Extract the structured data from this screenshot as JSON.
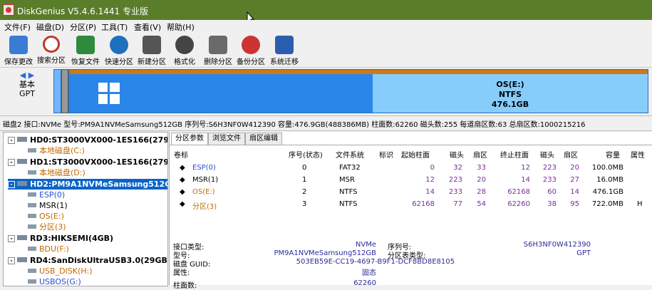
{
  "window": {
    "title": "DiskGenius V5.4.6.1441 专业版"
  },
  "menu": [
    "文件(F)",
    "磁盘(D)",
    "分区(P)",
    "工具(T)",
    "查看(V)",
    "帮助(H)"
  ],
  "toolbar": [
    {
      "label": "保存更改",
      "icon": "save-icon",
      "color": "#3a7bd5"
    },
    {
      "label": "搜索分区",
      "icon": "search-icon",
      "color": "#c0392b"
    },
    {
      "label": "恢复文件",
      "icon": "recover-icon",
      "color": "#2e8b3e"
    },
    {
      "label": "快速分区",
      "icon": "quick-partition-icon",
      "color": "#1f6fbf"
    },
    {
      "label": "新建分区",
      "icon": "new-partition-icon",
      "color": "#555555"
    },
    {
      "label": "格式化",
      "icon": "format-icon",
      "color": "#444444"
    },
    {
      "label": "删除分区",
      "icon": "delete-icon",
      "color": "#6a6a6a"
    },
    {
      "label": "备份分区",
      "icon": "backup-icon",
      "color": "#cc3333"
    },
    {
      "label": "系统迁移",
      "icon": "migrate-icon",
      "color": "#2a5fb0"
    }
  ],
  "diskmap": {
    "nav_line1": "基本",
    "nav_line2": "GPT",
    "os_label": "OS(E:)",
    "os_fs": "NTFS",
    "os_size": "476.1GB"
  },
  "infobar": "磁盘2 接口:NVMe  型号:PM9A1NVMeSamsung512GB  序列号:S6H3NF0W412390  容量:476.9GB(488386MB)  柱面数:62260  磁头数:255  每道扇区数:63  总扇区数:1000215216",
  "tree": [
    {
      "text": "HD0:ST3000VX000-1ES166(2795G",
      "type": "disk",
      "expand": "-"
    },
    {
      "text": "本地磁盘(C:)",
      "type": "part"
    },
    {
      "text": "HD1:ST3000VX000-1ES166(2795G",
      "type": "disk",
      "expand": "-"
    },
    {
      "text": "本地磁盘(D:)",
      "type": "part"
    },
    {
      "text": "HD2:PM9A1NVMeSamsung512GB",
      "type": "disk",
      "expand": "-",
      "selected": true
    },
    {
      "text": "ESP(0)",
      "type": "part",
      "color": "blue"
    },
    {
      "text": "MSR(1)",
      "type": "part",
      "color": "black"
    },
    {
      "text": "OS(E:)",
      "type": "part"
    },
    {
      "text": "分区(3)",
      "type": "part"
    },
    {
      "text": "RD3:HIKSEMI(4GB)",
      "type": "disk",
      "expand": "-"
    },
    {
      "text": "BDU(F:)",
      "type": "part"
    },
    {
      "text": "RD4:SanDiskUltraUSB3.0(29GB)",
      "type": "disk",
      "expand": "-"
    },
    {
      "text": "USB_DISK(H:)",
      "type": "part"
    },
    {
      "text": "USBOS(G:)",
      "type": "part"
    }
  ],
  "tabs": [
    "分区参数",
    "浏览文件",
    "扇区编辑"
  ],
  "columns": [
    "卷标",
    "序号(状态)",
    "文件系统",
    "标识",
    "起始柱面",
    "磁头",
    "扇区",
    "终止柱面",
    "磁头",
    "扇区",
    "容量",
    "属性"
  ],
  "rows": [
    {
      "label": "ESP(0)",
      "idx": "0",
      "fs": "FAT32",
      "id": "",
      "sc": "0",
      "sh": "32",
      "ss": "33",
      "ec": "12",
      "eh": "223",
      "es": "20",
      "cap": "100.0MB",
      "attr": ""
    },
    {
      "label": "MSR(1)",
      "idx": "1",
      "fs": "MSR",
      "id": "",
      "sc": "12",
      "sh": "223",
      "ss": "20",
      "ec": "14",
      "eh": "233",
      "es": "27",
      "cap": "16.0MB",
      "attr": ""
    },
    {
      "label": "OS(E:)",
      "idx": "2",
      "fs": "NTFS",
      "id": "",
      "sc": "14",
      "sh": "233",
      "ss": "28",
      "ec": "62168",
      "eh": "60",
      "es": "14",
      "cap": "476.1GB",
      "attr": ""
    },
    {
      "label": "分区(3)",
      "idx": "3",
      "fs": "NTFS",
      "id": "",
      "sc": "62168",
      "sh": "77",
      "ss": "54",
      "ec": "62260",
      "eh": "38",
      "es": "95",
      "cap": "722.0MB",
      "attr": "H"
    }
  ],
  "details": {
    "interface_label": "接口类型:",
    "interface_value": "NVMe",
    "model_label": "型号:",
    "model_value": "PM9A1NVMeSamsung512GB",
    "guid_label": "磁盘 GUID:",
    "guid_value": "503EB59E-CC19-4697-B9F1-DCF8BD8E8105",
    "attr_label": "属性:",
    "attr_value": "固态",
    "serial_label": "序列号:",
    "serial_value": "S6H3NF0W412390",
    "ptype_label": "分区表类型:",
    "ptype_value": "GPT",
    "cyl_label": "柱面数:",
    "cyl_value": "62260"
  }
}
